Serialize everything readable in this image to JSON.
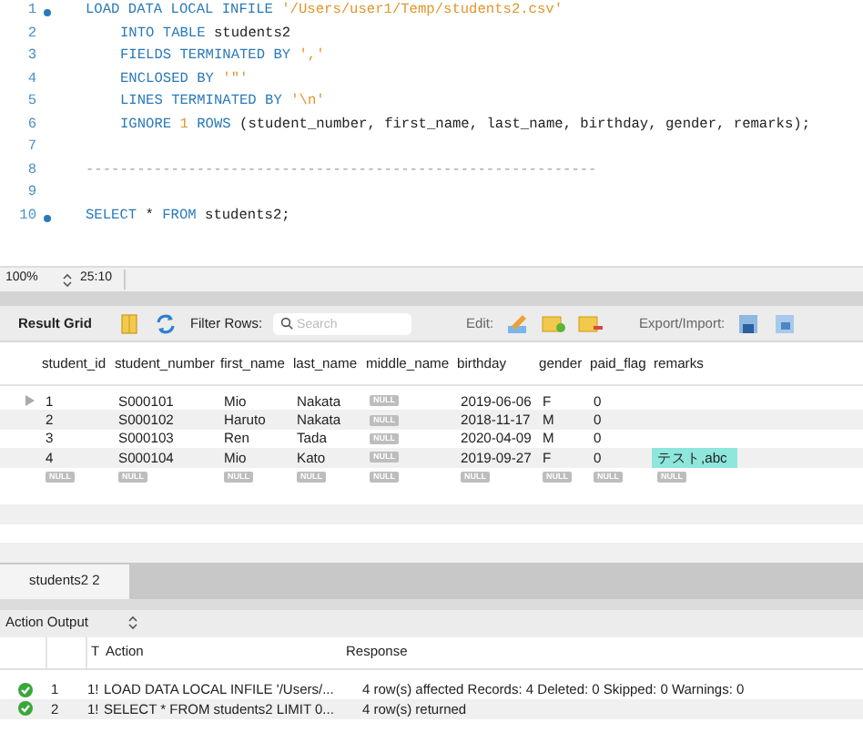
{
  "editor": {
    "lines": [
      {
        "number": "1",
        "marker": true,
        "indented": false,
        "tokens": [
          {
            "kind": "keyword",
            "text": "LOAD DATA LOCAL INFILE"
          },
          {
            "kind": "string",
            "text": "'/Users/user1/Temp/students2.csv'"
          }
        ]
      },
      {
        "number": "2",
        "marker": false,
        "indented": true,
        "tokens": [
          {
            "kind": "keyword",
            "text": "INTO TABLE"
          },
          {
            "kind": "plain",
            "text": "students2"
          }
        ]
      },
      {
        "number": "3",
        "marker": false,
        "indented": true,
        "tokens": [
          {
            "kind": "keyword",
            "text": "FIELDS TERMINATED BY"
          },
          {
            "kind": "string",
            "text": "','"
          }
        ]
      },
      {
        "number": "4",
        "marker": false,
        "indented": true,
        "tokens": [
          {
            "kind": "keyword",
            "text": "ENCLOSED BY"
          },
          {
            "kind": "string",
            "text": "'\"'"
          }
        ]
      },
      {
        "number": "5",
        "marker": false,
        "indented": true,
        "tokens": [
          {
            "kind": "keyword",
            "text": "LINES TERMINATED BY"
          },
          {
            "kind": "string",
            "text": "'\\n'"
          }
        ]
      },
      {
        "number": "6",
        "marker": false,
        "indented": true,
        "tokens": [
          {
            "kind": "keyword",
            "text": "IGNORE"
          },
          {
            "kind": "number",
            "text": "1"
          },
          {
            "kind": "keyword",
            "text": "ROWS"
          },
          {
            "kind": "plain",
            "text": "(student_number, first_name, last_name, birthday, gender, remarks);"
          }
        ]
      },
      {
        "number": "7",
        "marker": false
      },
      {
        "number": "8",
        "marker": false,
        "indented": false,
        "tokens": [
          {
            "kind": "comment",
            "text": "------------------------------------------------------------"
          }
        ]
      },
      {
        "number": "9",
        "marker": false
      },
      {
        "number": "10",
        "marker": true,
        "indented": false,
        "tokens": [
          {
            "kind": "keyword",
            "text": "SELECT"
          },
          {
            "kind": "plain",
            "text": "*"
          },
          {
            "kind": "keyword",
            "text": "FROM"
          },
          {
            "kind": "plain",
            "text": "students2;"
          }
        ]
      }
    ]
  },
  "status_bar": {
    "zoom": "100%",
    "position": "25:10"
  },
  "result_toolbar": {
    "title": "Result Grid",
    "filter_label": "Filter Rows:",
    "search": {
      "placeholder": "Search"
    },
    "edit_label": "Edit:",
    "export_label": "Export/Import:"
  },
  "grid": {
    "columns": [
      "student_id",
      "student_number",
      "first_name",
      "last_name",
      "middle_name",
      "birthday",
      "gender",
      "paid_flag",
      "remarks"
    ],
    "rows": [
      {
        "current": true,
        "cells": [
          {
            "kind": "text",
            "text": "1",
            "selected": false
          },
          {
            "kind": "text",
            "text": "S000101",
            "selected": false
          },
          {
            "kind": "text",
            "text": "Mio",
            "selected": false
          },
          {
            "kind": "text",
            "text": "Nakata",
            "selected": false
          },
          {
            "kind": "null",
            "text": "NULL",
            "selected": false
          },
          {
            "kind": "text",
            "text": "2019-06-06",
            "selected": false
          },
          {
            "kind": "text",
            "text": "F",
            "selected": false
          },
          {
            "kind": "text",
            "text": "0",
            "selected": false
          },
          {
            "kind": "empty",
            "selected": false
          }
        ]
      },
      {
        "current": false,
        "cells": [
          {
            "kind": "text",
            "text": "2",
            "selected": false
          },
          {
            "kind": "text",
            "text": "S000102",
            "selected": false
          },
          {
            "kind": "text",
            "text": "Haruto",
            "selected": false
          },
          {
            "kind": "text",
            "text": "Nakata",
            "selected": false
          },
          {
            "kind": "null",
            "text": "NULL",
            "selected": false
          },
          {
            "kind": "text",
            "text": "2018-11-17",
            "selected": false
          },
          {
            "kind": "text",
            "text": "M",
            "selected": false
          },
          {
            "kind": "text",
            "text": "0",
            "selected": false
          },
          {
            "kind": "empty",
            "selected": false
          }
        ]
      },
      {
        "current": false,
        "cells": [
          {
            "kind": "text",
            "text": "3",
            "selected": false
          },
          {
            "kind": "text",
            "text": "S000103",
            "selected": false
          },
          {
            "kind": "text",
            "text": "Ren",
            "selected": false
          },
          {
            "kind": "text",
            "text": "Tada",
            "selected": false
          },
          {
            "kind": "null",
            "text": "NULL",
            "selected": false
          },
          {
            "kind": "text",
            "text": "2020-04-09",
            "selected": false
          },
          {
            "kind": "text",
            "text": "M",
            "selected": false
          },
          {
            "kind": "text",
            "text": "0",
            "selected": false
          },
          {
            "kind": "empty",
            "selected": false
          }
        ]
      },
      {
        "current": false,
        "cells": [
          {
            "kind": "text",
            "text": "4",
            "selected": false
          },
          {
            "kind": "text",
            "text": "S000104",
            "selected": false
          },
          {
            "kind": "text",
            "text": "Mio",
            "selected": false
          },
          {
            "kind": "text",
            "text": "Kato",
            "selected": false
          },
          {
            "kind": "null",
            "text": "NULL",
            "selected": false
          },
          {
            "kind": "text",
            "text": "2019-09-27",
            "selected": false
          },
          {
            "kind": "text",
            "text": "F",
            "selected": false
          },
          {
            "kind": "text",
            "text": "0",
            "selected": false
          },
          {
            "kind": "text",
            "text": "テスト,abc",
            "selected": true
          }
        ]
      },
      {
        "current": false,
        "cells": [
          {
            "kind": "null",
            "text": "NULL",
            "selected": false
          },
          {
            "kind": "null",
            "text": "NULL",
            "selected": false
          },
          {
            "kind": "null",
            "text": "NULL",
            "selected": false
          },
          {
            "kind": "null",
            "text": "NULL",
            "selected": false
          },
          {
            "kind": "null",
            "text": "NULL",
            "selected": false
          },
          {
            "kind": "null",
            "text": "NULL",
            "selected": false
          },
          {
            "kind": "null",
            "text": "NULL",
            "selected": false
          },
          {
            "kind": "null",
            "text": "NULL",
            "selected": false
          },
          {
            "kind": "null",
            "text": "NULL",
            "selected": false
          }
        ]
      }
    ]
  },
  "result_tabs": [
    {
      "label": "students2 2",
      "selected": true
    }
  ],
  "output": {
    "title": "Action Output",
    "columns": [
      "T",
      "Action",
      "Response"
    ],
    "rows": [
      {
        "kind": "success",
        "number": "1",
        "time": "1!",
        "action": "LOAD DATA LOCAL INFILE '/Users/...",
        "response": "4 row(s) affected Records: 4  Deleted: 0  Skipped: 0  Warnings: 0"
      },
      {
        "kind": "success",
        "number": "2",
        "time": "1!",
        "action": "SELECT * FROM students2 LIMIT 0...",
        "response": "4 row(s) returned"
      }
    ]
  }
}
